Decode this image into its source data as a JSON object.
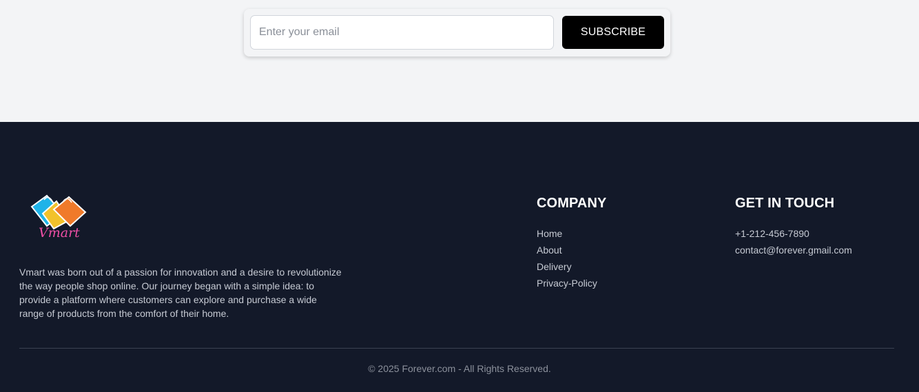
{
  "newsletter": {
    "email_placeholder": "Enter your email",
    "subscribe_label": "SUBSCRIBE"
  },
  "footer": {
    "logo_text": "Vmart",
    "about": "Vmart was born out of a passion for innovation and a desire to revolutionize the way people shop online. Our journey began with a simple idea: to provide a platform where customers can explore and purchase a wide range of products from the comfort of their home.",
    "company": {
      "title": "COMPANY",
      "links": [
        "Home",
        "About",
        "Delivery",
        "Privacy-Policy"
      ]
    },
    "contact": {
      "title": "GET IN TOUCH",
      "phone": "+1-212-456-7890",
      "email": "contact@forever.gmail.com"
    },
    "copyright": "© 2025 Forever.com - All Rights Reserved."
  },
  "colors": {
    "page_bg": "#f3f4f6",
    "footer_bg": "#131929",
    "button_bg": "#000000"
  }
}
